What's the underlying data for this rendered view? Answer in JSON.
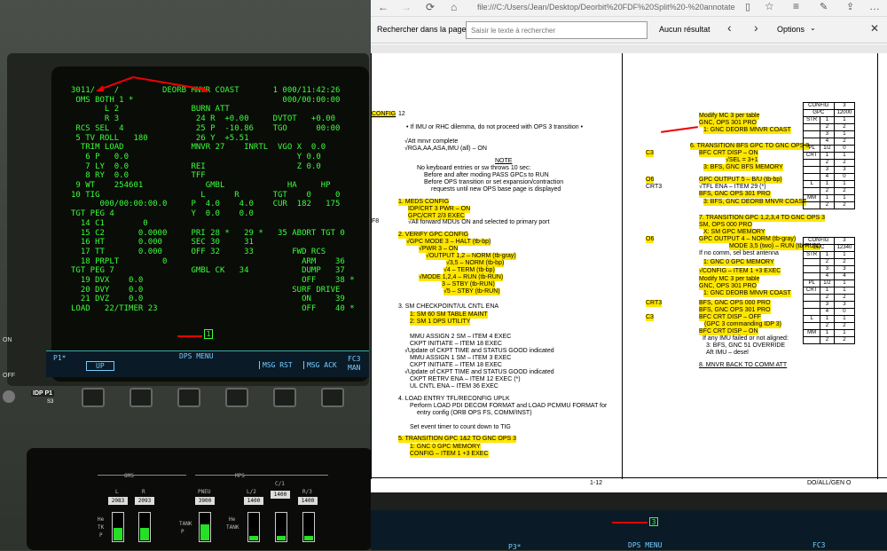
{
  "crt": {
    "lines": [
      "3011/    /         DEORB MNVR COAST       1 000/11:42:26",
      " OMS BOTH 1 *                               000/00:00:00",
      "       L 2               BURN ATT",
      "       R 3                24 R  +0.00     DVTOT   +0.00",
      " RCS SEL  4               25 P  -10.86    TGO      00:00",
      " 5 TV ROLL   180          26 Y  +5.51",
      "  TRIM LOAD              MNVR 27    INRTL  VGO X  0.0",
      "   6 P   0.0                                   Y 0.0",
      "   7 LY  0.0             REI                   Z 0.0",
      "   8 RY  0.0             TFF",
      " 9 WT    254601             GMBL             HA     HP",
      "10 TIG                     L      R       TGT    0     0",
      "      000/00:00:00.0     P  4.0    4.0    CUR  182   175",
      "TGT PEG 4                Y  0.0    0.0",
      "  14 C1        0",
      "  15 C2       0.0000     PRI 28 *   29 *   35 ABORT TGT 0",
      "  16 HT       0.000      SEC 30     31",
      "  17 TT       0.000      OFF 32     33        FWD RCS",
      "  18 PRPLT         0                            ARM    36",
      "TGT PEG 7                GMBL CK   34           DUMP   37",
      "  19 DVX    0.0                                 OFF    38 *",
      "  20 DVY    0.0                               SURF DRIVE",
      "  21 DVZ    0.0                                 ON     39",
      "LOAD   22/TIMER 23                              OFF    40 *"
    ],
    "scratch": "1"
  },
  "dps": {
    "p1": "P1*",
    "menu": "DPS MENU",
    "up": "UP",
    "msg_rst": "MSG RST",
    "msg_ack": "MSG ACK",
    "fc3": "FC3",
    "man": "MAN",
    "idp": "IDP P1",
    "idp2": "S3",
    "on": "ON",
    "off": "OFF"
  },
  "lower": {
    "oms": "OMS",
    "mps": "MPS",
    "l": "L",
    "r": "R",
    "l_val": "2083",
    "r_val": "2093",
    "pneu": "PNEU",
    "pneu_val": "3900",
    "l2": "L/2",
    "l2_val": "1400",
    "c1": "C/1",
    "c1_val": "1400",
    "r3": "R/3",
    "r3_val": "1400",
    "he": "He",
    "tk": "TK",
    "p": "P",
    "tank": "TANK",
    "he2": "He",
    "tank2": "TANK",
    "p2": "P"
  },
  "browser": {
    "url": "file:///C:/Users/Jean/Desktop/Deorbit%20FDF%20Split%20-%20annotate",
    "find_label": "Rechercher dans la page",
    "find_placeholder": "Saisir le texte à rechercher",
    "result": "Aucun résultat",
    "options": "Options"
  },
  "doc": {
    "left": [
      {
        "t": "CONFIG",
        "c": "hl ul"
      },
      {
        "t": "12",
        "c": ""
      },
      {
        "t": "• If IMU or RHC dilemma, do not proceed with OPS 3 transition  •",
        "c": ""
      },
      {
        "t": "√Att mnvr complete",
        "c": ""
      },
      {
        "t": "√RGA,AA,ASA,IMU (all) – ON",
        "c": ""
      },
      {
        "t": "NOTE",
        "c": "ul"
      },
      {
        "t": "No keyboard entries or sw throws 10 sec:",
        "c": ""
      },
      {
        "t": "Before and after moding PASS GPCs to RUN",
        "c": ""
      },
      {
        "t": "Before OPS transition or set expansion/contraction",
        "c": ""
      },
      {
        "t": "requests until new OPS base page is displayed",
        "c": ""
      },
      {
        "t": "1.   MEDS CONFIG",
        "c": "hl"
      },
      {
        "t": "IDP/CRT 3 PWR – ON",
        "c": "hl"
      },
      {
        "t": "GPC/CRT 2/3 EXEC",
        "c": "hl"
      },
      {
        "t": "F8",
        "c": ""
      },
      {
        "t": "√All forward MDUs ON and selected to primary port",
        "c": ""
      },
      {
        "t": "2.   VERIFY GPC CONFIG",
        "c": "hl"
      },
      {
        "t": "√GPC MODE 3 – HALT (tb-bp)",
        "c": "hl"
      },
      {
        "t": "√PWR 3 – ON",
        "c": "hl"
      },
      {
        "t": "√OUTPUT 1,2 – NORM (tb-gray)",
        "c": "hl"
      },
      {
        "t": "√3,5 – NORM (tb-bp)",
        "c": "hl"
      },
      {
        "t": "√4   – TERM (tb-bp)",
        "c": "hl"
      },
      {
        "t": "√MODE 1,2,4 – RUN (tb-RUN)",
        "c": "hl"
      },
      {
        "t": "3      – STBY (tb-RUN)",
        "c": "hl"
      },
      {
        "t": "√5    – STBY (tb-RUN)",
        "c": "hl"
      },
      {
        "t": "3.   SM CHECKPOINT/UL CNTL ENA",
        "c": ""
      },
      {
        "t": "1:  SM 60 SM TABLE MAINT",
        "c": "hl"
      },
      {
        "t": "2:  SM 1 DPS UTILITY",
        "c": "hl"
      },
      {
        "t": "MMU ASSIGN 2 SM – ITEM 4 EXEC",
        "c": ""
      },
      {
        "t": "CKPT INITIATE – ITEM 18 EXEC",
        "c": ""
      },
      {
        "t": "√Update of CKPT TIME and STATUS GOOD indicated",
        "c": ""
      },
      {
        "t": "MMU ASSIGN 1 SM – ITEM 3 EXEC",
        "c": ""
      },
      {
        "t": "CKPT INITIATE – ITEM 18 EXEC",
        "c": ""
      },
      {
        "t": "√Update of CKPT TIME and STATUS GOOD indicated",
        "c": ""
      },
      {
        "t": "CKPT RETRV ENA – ITEM 12 EXEC (*)",
        "c": ""
      },
      {
        "t": "UL CNTL ENA – ITEM 36 EXEC",
        "c": ""
      },
      {
        "t": "4.   LOAD ENTRY TFL/RECONFIG UPLK",
        "c": ""
      },
      {
        "t": "Perform LOAD PDI DECOM FORMAT and LOAD PCMMU FORMAT for",
        "c": ""
      },
      {
        "t": "entry config (ORB OPS FS, COMM/INST)",
        "c": ""
      },
      {
        "t": "Set event timer to count down to TIG",
        "c": ""
      },
      {
        "t": "5.   TRANSITION GPC 1&2 TO GNC OPS 3",
        "c": "hl"
      },
      {
        "t": "1:  GNC 0 GPC MEMORY",
        "c": "hl"
      },
      {
        "t": "CONFIG – ITEM 1 +3 EXEC",
        "c": "hl"
      }
    ],
    "right": [
      {
        "t": "Modify MC 3 per table",
        "c": "hl"
      },
      {
        "t": "GNC, OPS 301 PRO",
        "c": "hl"
      },
      {
        "t": "1:  GNC DEORB MNVR COAST",
        "c": "hl"
      },
      {
        "t": "6.   TRANSITION BFS GPC TO GNC OPS 3",
        "c": "hl"
      },
      {
        "t": "C3",
        "c": "hl"
      },
      {
        "t": "BFC CRT DISP – ON",
        "c": "hl"
      },
      {
        "t": "√SEL = 3+1",
        "c": "hl"
      },
      {
        "t": "3:  BFS, GNC BFS MEMORY",
        "c": "hl"
      },
      {
        "t": "O6",
        "c": "hl"
      },
      {
        "t": "GPC OUTPUT 5 – B/U (tb-bp)",
        "c": "hl"
      },
      {
        "t": "CRT3",
        "c": ""
      },
      {
        "t": "√TFL ENA – ITEM 29 (*)",
        "c": ""
      },
      {
        "t": "BFS, GNC OPS 301 PRO",
        "c": "hl"
      },
      {
        "t": "3:  BFS, GNC DEORB MNVR COAST",
        "c": "hl"
      },
      {
        "t": "7.   TRANSITION GPC 1,2,3,4 TO GNC OPS 3",
        "c": "hl"
      },
      {
        "t": "SM, OPS 000 PRO",
        "c": "hl"
      },
      {
        "t": "X:  SM GPC MEMORY",
        "c": "hl"
      },
      {
        "t": "O6",
        "c": "hl"
      },
      {
        "t": "GPC OUTPUT 4 – NORM (tb-gray)",
        "c": "hl"
      },
      {
        "t": "MODE 3,5 (two) – RUN (tb-RUN)",
        "c": "hl"
      },
      {
        "t": "If no comm, sel best antenna",
        "c": ""
      },
      {
        "t": "1:  GNC 0 GPC MEMORY",
        "c": "hl"
      },
      {
        "t": "√CONFIG – ITEM 1 +3 EXEC",
        "c": "hl"
      },
      {
        "t": "Modify MC 3 per table",
        "c": "hl"
      },
      {
        "t": "GNC, OPS 301 PRO",
        "c": "hl"
      },
      {
        "t": "1:  GNC DEORB MNVR COAST",
        "c": "hl"
      },
      {
        "t": "CRT3",
        "c": "hl"
      },
      {
        "t": "BFS, GNC OPS 000 PRO",
        "c": "hl"
      },
      {
        "t": "BFS, GNC OPS 301 PRO",
        "c": "hl"
      },
      {
        "t": "C3",
        "c": "hl"
      },
      {
        "t": "BFC CRT DISP – OFF",
        "c": "hl"
      },
      {
        "t": "(GPC 3 commanding IDP 3)",
        "c": "hl"
      },
      {
        "t": "BFC CRT DISP – ON",
        "c": "hl"
      },
      {
        "t": "If any IMU failed or not aligned:",
        "c": ""
      },
      {
        "t": "3:  BFS, GNC 51 OVERRIDE",
        "c": ""
      },
      {
        "t": "Aft IMU – desel",
        "c": ""
      },
      {
        "t": "8.   MNVR BACK TO COMM ATT",
        "c": "ul"
      }
    ],
    "page_num": "1-12",
    "footer": "DO/ALL/GEN O",
    "t1": {
      "h1": "CONFIG",
      "h2": "3",
      "h3": "GPC",
      "h4": "12000",
      "rows": [
        [
          "STR",
          "1",
          "1"
        ],
        [
          "",
          "2",
          "2"
        ],
        [
          "",
          "3",
          "1"
        ],
        [
          "",
          "4",
          "2"
        ],
        [
          "PL",
          "1/2",
          "0"
        ],
        [
          "CRT",
          "1",
          "1"
        ],
        [
          "",
          "2",
          "2"
        ],
        [
          "",
          "3",
          "3"
        ],
        [
          "",
          "4",
          "0"
        ],
        [
          "L",
          "1",
          "1"
        ],
        [
          "",
          "2",
          "2"
        ],
        [
          "MM",
          "1",
          "1"
        ],
        [
          "",
          "2",
          "2"
        ]
      ]
    },
    "t2": {
      "h1": "CONFIG",
      "h2": "3",
      "h3": "GPC",
      "h4": "12340",
      "rows": [
        [
          "STR",
          "1",
          "1"
        ],
        [
          "",
          "2",
          "2"
        ],
        [
          "",
          "3",
          "3"
        ],
        [
          "",
          "4",
          "4"
        ],
        [
          "PL",
          "1/2",
          "1"
        ],
        [
          "CRT",
          "1",
          "1"
        ],
        [
          "",
          "2",
          "2"
        ],
        [
          "",
          "3",
          "3"
        ],
        [
          "",
          "4",
          "0"
        ],
        [
          "L",
          "1",
          "1"
        ],
        [
          "",
          "2",
          "2"
        ],
        [
          "MM",
          "1",
          "1"
        ],
        [
          "",
          "2",
          "2"
        ]
      ]
    }
  },
  "bottom": {
    "p3": "P3*",
    "menu": "DPS MENU",
    "fc3": "FC3",
    "scratch": "3"
  }
}
